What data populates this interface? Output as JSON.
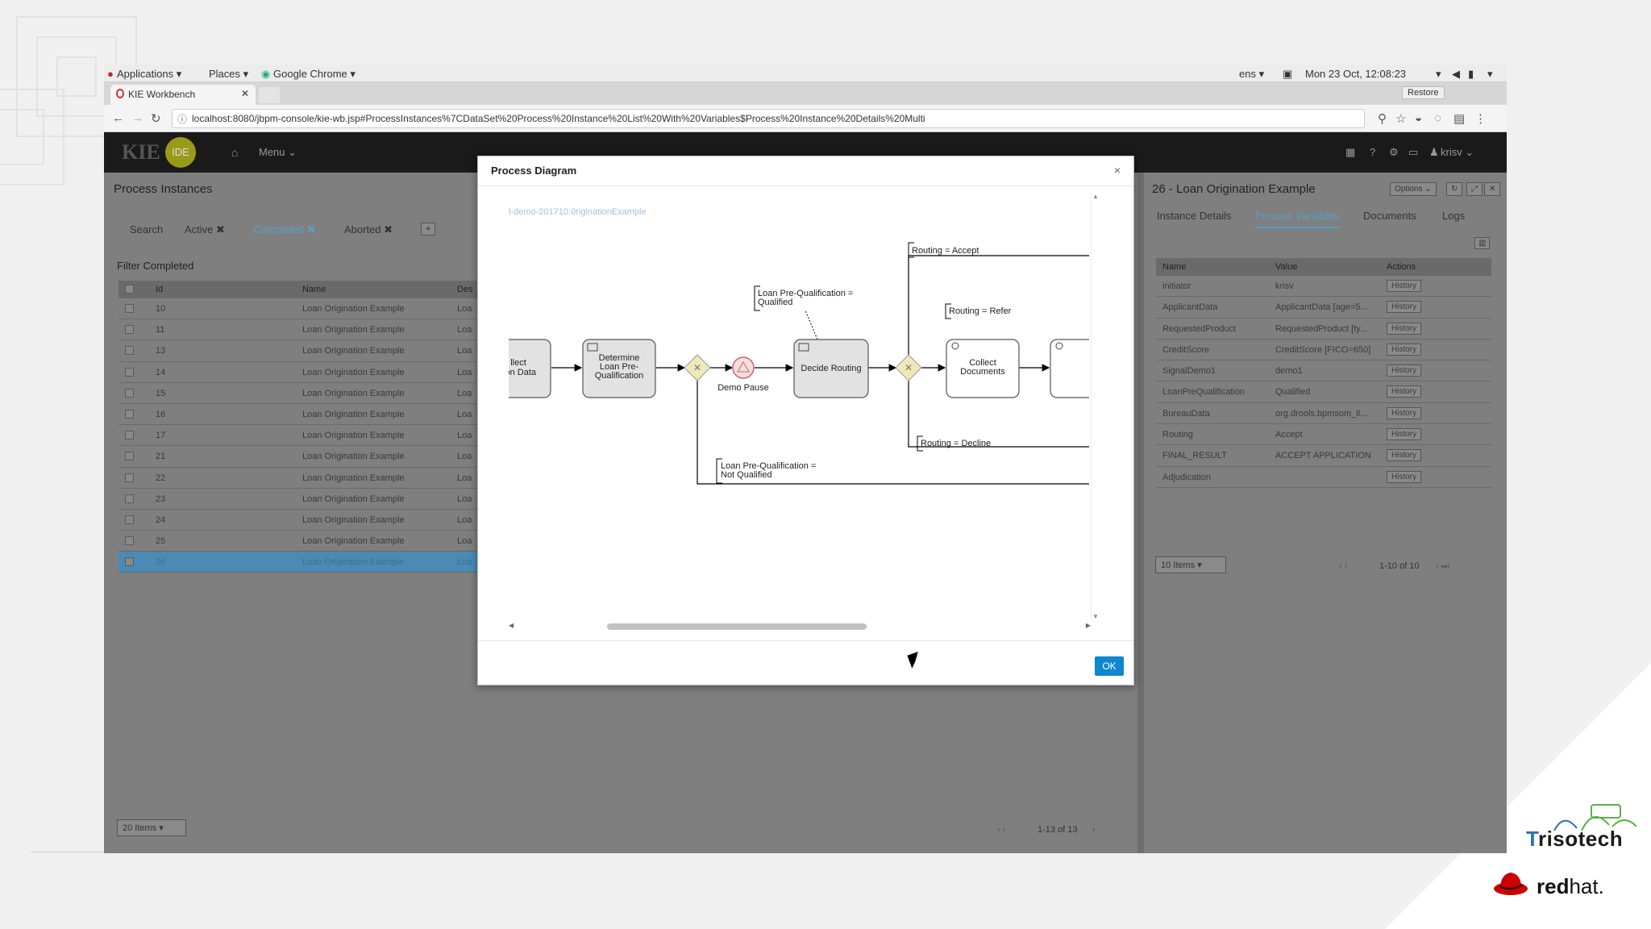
{
  "gnome_bar": {
    "applications": "Applications ▾",
    "places": "Places ▾",
    "browser": "Google Chrome ▾",
    "lang": "ens ▾",
    "clock": "Mon 23 Oct, 12:08:23"
  },
  "browser": {
    "tab_title": "KIE Workbench",
    "tab_close": "✕",
    "url": "localhost:8080/jbpm-console/kie-wb.jsp#ProcessInstances%7CDataSet%20Process%20Instance%20List%20With%20Variables$Process%20Instance%20Details%20Multi",
    "restore": "Restore"
  },
  "app_header": {
    "logo": "KIE",
    "logo_badge": "IDE",
    "menu": "Menu ⌄",
    "user": "krisv ⌄"
  },
  "left_panel": {
    "title": "Process Instances",
    "filter_tabs": [
      "Search",
      "Active ✖",
      "Completed ✖",
      "Aborted ✖"
    ],
    "add_tab": "+",
    "filter_label": "Filter Completed",
    "columns": [
      "Id",
      "Name",
      "Des"
    ],
    "rows": [
      {
        "id": "10",
        "name": "Loan Origination Example",
        "desc": "Loa"
      },
      {
        "id": "11",
        "name": "Loan Origination Example",
        "desc": "Loa"
      },
      {
        "id": "13",
        "name": "Loan Origination Example",
        "desc": "Loa"
      },
      {
        "id": "14",
        "name": "Loan Origination Example",
        "desc": "Loa"
      },
      {
        "id": "15",
        "name": "Loan Origination Example",
        "desc": "Loa"
      },
      {
        "id": "16",
        "name": "Loan Origination Example",
        "desc": "Loa"
      },
      {
        "id": "17",
        "name": "Loan Origination Example",
        "desc": "Loa"
      },
      {
        "id": "21",
        "name": "Loan Origination Example",
        "desc": "Loa"
      },
      {
        "id": "22",
        "name": "Loan Origination Example",
        "desc": "Loa"
      },
      {
        "id": "23",
        "name": "Loan Origination Example",
        "desc": "Loa"
      },
      {
        "id": "24",
        "name": "Loan Origination Example",
        "desc": "Loa"
      },
      {
        "id": "25",
        "name": "Loan Origination Example",
        "desc": "Loa"
      },
      {
        "id": "26",
        "name": "Loan Origination Example",
        "desc": "Loa"
      }
    ],
    "selected_row": 12,
    "page_size": "20 Items",
    "pager": "1-13 of 13"
  },
  "right_panel": {
    "title": "26 - Loan Origination Example",
    "options": "Options ⌄",
    "tabs": [
      "Instance Details",
      "Process Variables",
      "Documents",
      "Logs"
    ],
    "active_tab": 1,
    "columns": [
      "Name",
      "Value",
      "Actions"
    ],
    "history_label": "History",
    "rows": [
      {
        "name": "initiator",
        "value": "krisv"
      },
      {
        "name": "ApplicantData",
        "value": "ApplicantData [age=5..."
      },
      {
        "name": "RequestedProduct",
        "value": "RequestedProduct [ty..."
      },
      {
        "name": "CreditScore",
        "value": "CreditScore [FICO=650]"
      },
      {
        "name": "SignalDemo1",
        "value": "demo1"
      },
      {
        "name": "LoanPreQualification",
        "value": "Qualified"
      },
      {
        "name": "BureauData",
        "value": "org.drools.bpmsom_il..."
      },
      {
        "name": "Routing",
        "value": "Accept"
      },
      {
        "name": "FINAL_RESULT",
        "value": "ACCEPT APPLICATION"
      },
      {
        "name": "Adjudication",
        "value": ""
      }
    ],
    "page_size": "10 Items",
    "pager": "1-10 of 10"
  },
  "modal": {
    "title": "Process Diagram",
    "close": "×",
    "ok": "OK",
    "process_id": "l-demo-201710.0riginationExample",
    "diagram": {
      "task_collect_data": [
        "llect",
        "tion Data"
      ],
      "task_determine": [
        "Determine",
        "Loan Pre-",
        "Qualification"
      ],
      "event_demo_pause": "Demo Pause",
      "task_decide": "Decide Routing",
      "task_collect_docs": [
        "Collect",
        "Documents"
      ],
      "ann_qualified": [
        "Loan Pre-Qualification =",
        "Qualified"
      ],
      "ann_not_qualified": [
        "Loan Pre-Qualification =",
        "Not Qualified"
      ],
      "ann_accept": "Routing = Accept",
      "ann_refer": "Routing = Refer",
      "ann_decline": "Routing = Decline"
    }
  },
  "brand": {
    "trisotech_t": "T",
    "trisotech_rest": "risotech",
    "redhat_bold": "red",
    "redhat_rest": "hat."
  }
}
